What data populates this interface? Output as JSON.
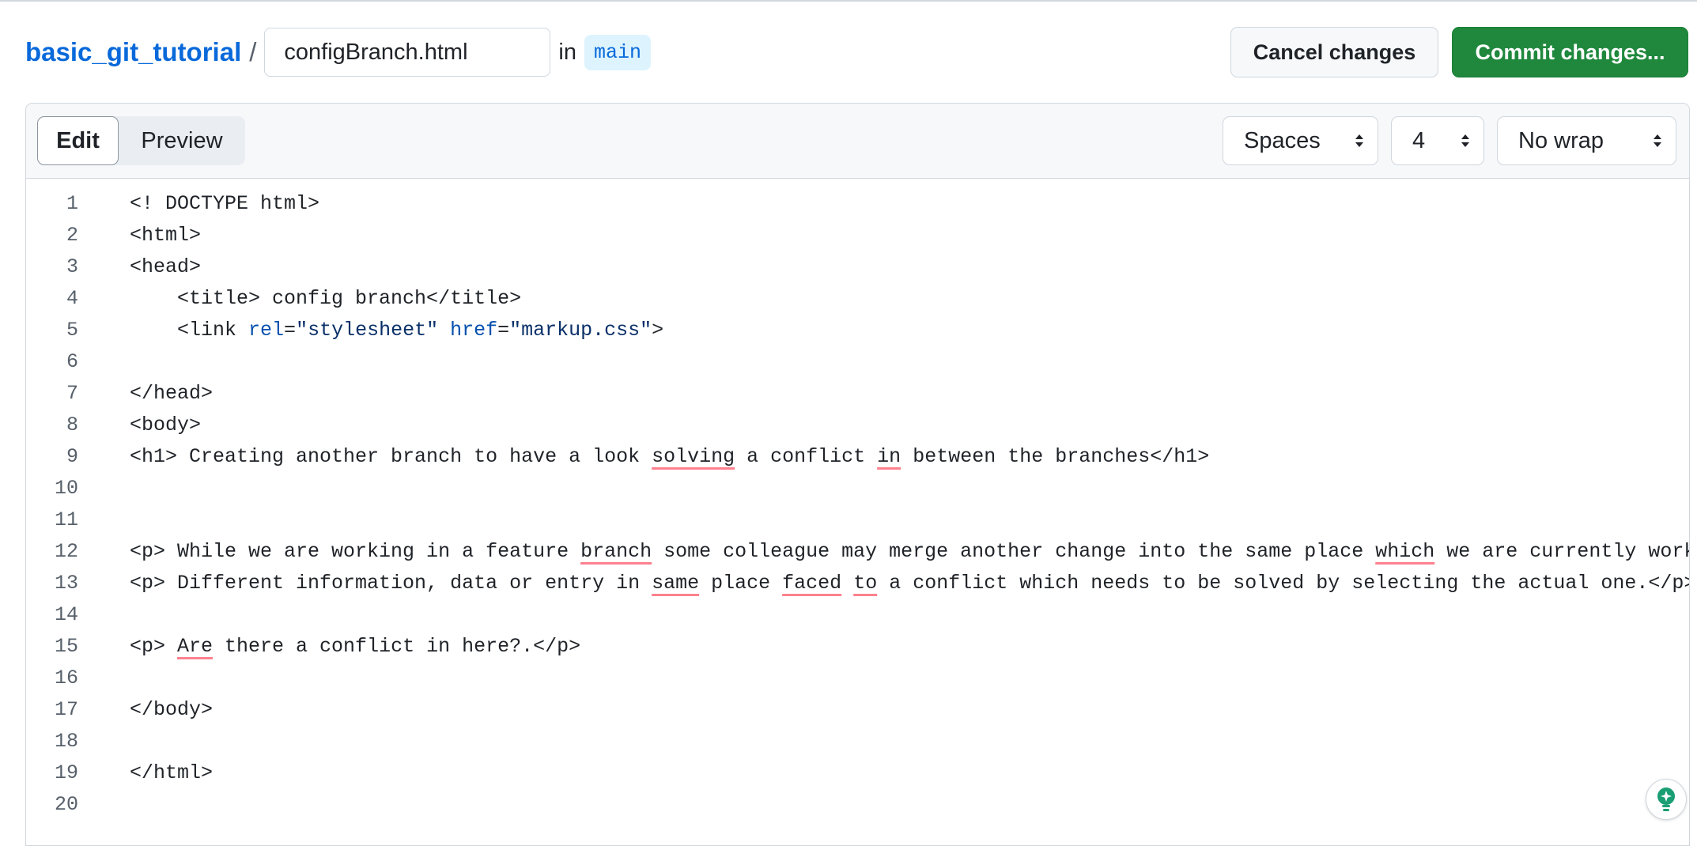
{
  "header": {
    "repo_name": "basic_git_tutorial",
    "separator": "/",
    "filename_value": "configBranch.html",
    "in_label": "in",
    "branch": "main",
    "cancel_label": "Cancel changes",
    "commit_label": "Commit changes..."
  },
  "editor": {
    "tabs": {
      "edit": "Edit",
      "preview": "Preview",
      "active": "Edit"
    },
    "indent_mode": "Spaces",
    "indent_size": "4",
    "wrap_mode": "No wrap",
    "hint_icon": "copilot-lightbulb-icon"
  },
  "code": {
    "line_numbers": [
      "1",
      "2",
      "3",
      "4",
      "5",
      "6",
      "7",
      "8",
      "9",
      "10",
      "11",
      "12",
      "13",
      "14",
      "15",
      "16",
      "17",
      "18",
      "19",
      "20"
    ],
    "lines": {
      "l1": "<! DOCTYPE html>",
      "l2": "<html>",
      "l3": "<head>",
      "l4": "    <title> config branch</title>",
      "l5": {
        "a": "    <link ",
        "b": "rel",
        "c": "=",
        "d": "\"stylesheet\"",
        "e": " ",
        "f": "href",
        "g": "=",
        "h": "\"markup.css\"",
        "i": ">"
      },
      "l6": "",
      "l7": "</head>",
      "l8": "<body>",
      "l9": {
        "a": "<h1> Creating another branch to have a look ",
        "b": "solving",
        "c": " a conflict ",
        "d": "in",
        "e": " between the branches</h1>"
      },
      "l10": "",
      "l11": "",
      "l12": {
        "a": "<p> While we are working in a feature ",
        "b": "branch",
        "c": " some colleague may merge another change into the same place ",
        "d": "which",
        "e": " we are currently working.<"
      },
      "l13": {
        "a": "<p> Different information, data or entry in ",
        "b": "same",
        "c": " place ",
        "d": "faced",
        "e": " ",
        "f": "to",
        "g": " a conflict which needs to be solved by selecting the actual one.</p>"
      },
      "l14": "",
      "l15": {
        "a": "<p> ",
        "b": "Are",
        "c": " there a conflict in here?.</p>"
      },
      "l16": "",
      "l17": "</body>",
      "l18": "",
      "l19": "</html>",
      "l20": ""
    }
  },
  "colors": {
    "link": "#0969da",
    "commit_button": "#1f883d",
    "branch_badge_bg": "#ddf4ff",
    "spellcheck_underline": "#ff818e",
    "attribute": "#0550ae",
    "string": "#0a3069"
  }
}
